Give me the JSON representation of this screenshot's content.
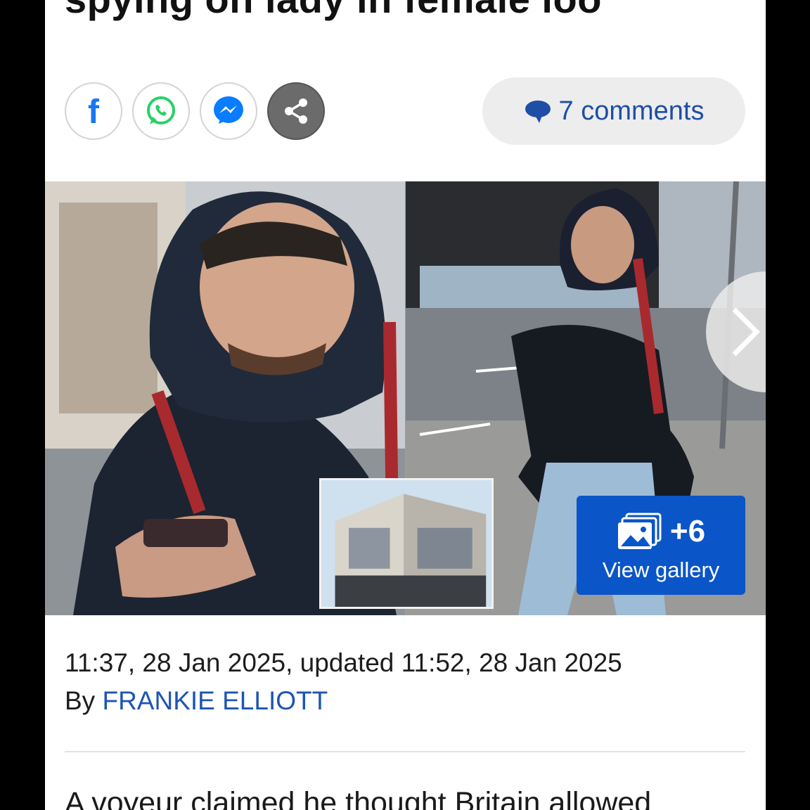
{
  "article": {
    "headline_visible": "spying on lady in female loo",
    "comments_label": "7 comments",
    "timestamp": "11:37, 28 Jan 2025, updated 11:52, 28 Jan 2025",
    "byline_prefix": "By",
    "author": "FRANKIE ELLIOTT",
    "body_start": "A voyeur claimed he thought Britain allowed"
  },
  "share": {
    "buttons": [
      {
        "icon": "facebook-icon"
      },
      {
        "icon": "whatsapp-icon"
      },
      {
        "icon": "messenger-icon"
      },
      {
        "icon": "share-icon"
      }
    ]
  },
  "gallery": {
    "count": "+6",
    "label": "View gallery"
  },
  "colors": {
    "link_blue": "#1e55b0",
    "gallery_blue": "#0a55c8",
    "facebook_blue": "#1877f2",
    "whatsapp_green": "#25d366",
    "messenger_blue": "#0a7cff"
  }
}
